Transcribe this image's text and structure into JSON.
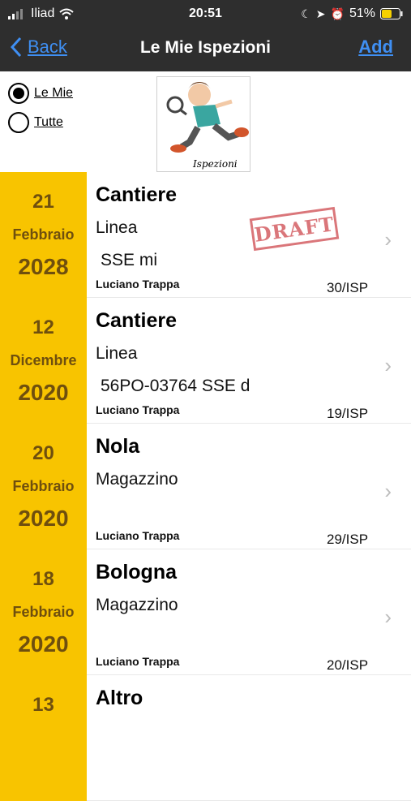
{
  "status": {
    "carrier": "Iliad",
    "time": "20:51",
    "battery": "51%"
  },
  "nav": {
    "back_label": "Back",
    "title": "Le Mie Ispezioni",
    "add_label": "Add"
  },
  "filter": {
    "options": [
      "Le Mie",
      "Tutte"
    ],
    "selected": "Le Mie"
  },
  "logo": {
    "caption": "Ispezioni"
  },
  "inspections": [
    {
      "day": "21",
      "month": "Febbraio",
      "year": "2028",
      "title": "Cantiere",
      "line1": "Linea",
      "line2": "SSE mi",
      "author": "Luciano Trappa",
      "code": "30/ISP",
      "badge": "DRAFT"
    },
    {
      "day": "12",
      "month": "Dicembre",
      "year": "2020",
      "title": "Cantiere",
      "line1": "Linea",
      "line2": "56PO-03764 SSE d",
      "author": "Luciano Trappa",
      "code": "19/ISP"
    },
    {
      "day": "20",
      "month": "Febbraio",
      "year": "2020",
      "title": "Nola",
      "line1": "Magazzino",
      "line2": "",
      "author": "Luciano Trappa",
      "code": "29/ISP"
    },
    {
      "day": "18",
      "month": "Febbraio",
      "year": "2020",
      "title": "Bologna",
      "line1": "Magazzino",
      "line2": "",
      "author": "Luciano Trappa",
      "code": "20/ISP"
    },
    {
      "day": "13",
      "month": "",
      "year": "",
      "title": "Altro",
      "line1": "",
      "line2": "",
      "author": "",
      "code": ""
    }
  ],
  "colors": {
    "accent": "#3f8ff3",
    "date_bg": "#f8c400",
    "bar_bg": "#2e2e2e",
    "draft": "#d2555a"
  }
}
